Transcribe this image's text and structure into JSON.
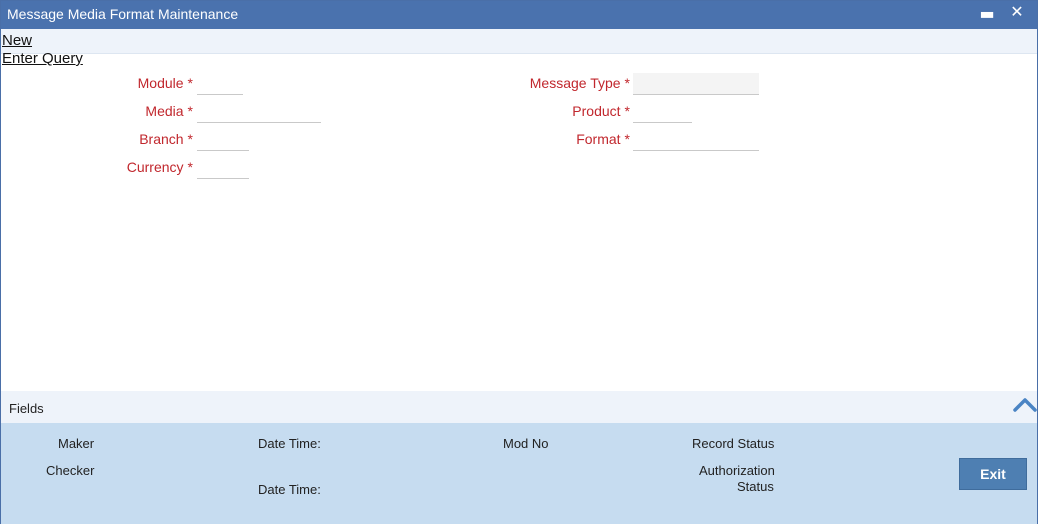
{
  "window": {
    "title": "Message Media Format Maintenance",
    "minimize_glyph": "▬",
    "close_glyph": "✕"
  },
  "toolbar": {
    "new_label": "New",
    "enter_query_label": "Enter Query"
  },
  "form": {
    "required_marker": "*",
    "module": {
      "label": "Module",
      "value": ""
    },
    "media": {
      "label": "Media",
      "value": ""
    },
    "branch": {
      "label": "Branch",
      "value": ""
    },
    "currency": {
      "label": "Currency",
      "value": ""
    },
    "message_type": {
      "label": "Message Type",
      "value": ""
    },
    "product": {
      "label": "Product",
      "value": ""
    },
    "format": {
      "label": "Format",
      "value": ""
    }
  },
  "fields_section": {
    "label": "Fields",
    "toggle_icon": "chevron-up-icon"
  },
  "audit": {
    "maker_label": "Maker",
    "checker_label": "Checker",
    "date_time_label": "Date Time:",
    "mod_no_label": "Mod No",
    "record_status_label": "Record Status",
    "authorization_label": "Authorization",
    "status_label": "Status"
  },
  "buttons": {
    "exit_label": "Exit"
  },
  "colors": {
    "titlebar": "#4a72ae",
    "required_label": "#c1272d",
    "footer": "#c6dcf0",
    "exit_button": "#4e7fb2"
  }
}
